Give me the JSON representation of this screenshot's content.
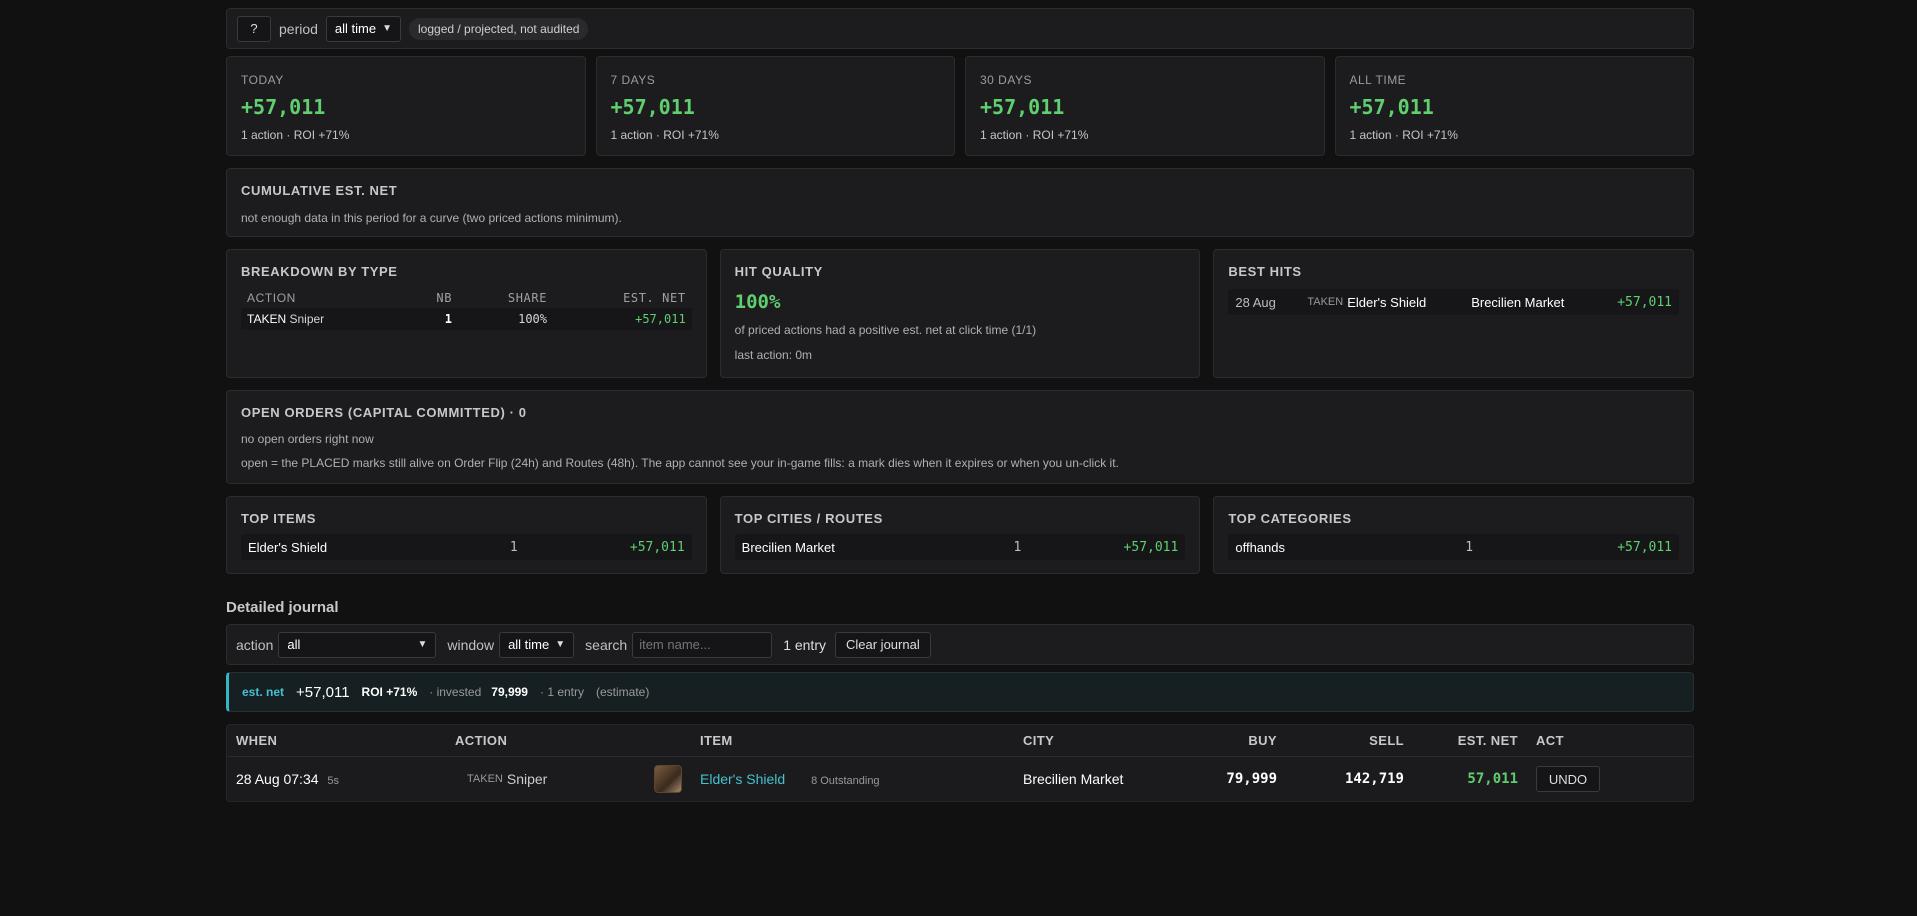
{
  "topbar": {
    "help_label": "?",
    "period_label": "period",
    "period_value": "all time",
    "badge": "logged / projected, not audited"
  },
  "stats": [
    {
      "title": "TODAY",
      "value": "+57,011",
      "sub": "1 action · ROI +71%"
    },
    {
      "title": "7 DAYS",
      "value": "+57,011",
      "sub": "1 action · ROI +71%"
    },
    {
      "title": "30 DAYS",
      "value": "+57,011",
      "sub": "1 action · ROI +71%"
    },
    {
      "title": "ALL TIME",
      "value": "+57,011",
      "sub": "1 action · ROI +71%"
    }
  ],
  "cumulative": {
    "title": "CUMULATIVE EST. NET",
    "desc": "not enough data in this period for a curve (two priced actions minimum)."
  },
  "breakdown": {
    "title": "BREAKDOWN BY TYPE",
    "headers": [
      "ACTION",
      "NB",
      "SHARE",
      "EST. NET"
    ],
    "rows": [
      {
        "tag": "TAKEN",
        "name": "Sniper",
        "nb": "1",
        "share": "100%",
        "net": "+57,011"
      }
    ]
  },
  "hit_quality": {
    "title": "HIT QUALITY",
    "value": "100%",
    "desc": "of priced actions had a positive est. net at click time (1/1)",
    "last": "last action: 0m"
  },
  "best_hits": {
    "title": "BEST HITS",
    "items": [
      {
        "date": "28 Aug",
        "tag": "TAKEN",
        "item": "Elder's Shield",
        "city": "Brecilien Market",
        "net": "+57,011"
      }
    ]
  },
  "open_orders": {
    "title": "OPEN ORDERS (CAPITAL COMMITTED) · 0",
    "line1": "no open orders right now",
    "line2": "open = the PLACED marks still alive on Order Flip (24h) and Routes (48h). The app cannot see your in-game fills: a mark dies when it expires or when you un-click it."
  },
  "top_items": {
    "title": "TOP ITEMS",
    "name": "Elder's Shield",
    "count": "1",
    "net": "+57,011"
  },
  "top_cities": {
    "title": "TOP CITIES / ROUTES",
    "name": "Brecilien Market",
    "count": "1",
    "net": "+57,011"
  },
  "top_categories": {
    "title": "TOP CATEGORIES",
    "name": "offhands",
    "count": "1",
    "net": "+57,011"
  },
  "journal": {
    "title": "Detailed journal",
    "action_label": "action",
    "action_value": "all",
    "window_label": "window",
    "window_value": "all time",
    "search_label": "search",
    "search_placeholder": "item name...",
    "entries": "1 entry",
    "clear_label": "Clear journal"
  },
  "summary": {
    "label": "est. net",
    "net": "+57,011",
    "roi": "ROI +71%",
    "invested_label": "· invested",
    "invested": "79,999",
    "entries": "· 1 entry",
    "note": "(estimate)"
  },
  "table": {
    "headers": [
      "WHEN",
      "ACTION",
      "ITEM",
      "CITY",
      "BUY",
      "SELL",
      "EST. NET",
      "ACT"
    ],
    "rows": [
      {
        "when": "28 Aug 07:34",
        "ago": "5s",
        "tag": "TAKEN",
        "action": "Sniper",
        "item": "Elder's Shield",
        "quality": "8 Outstanding",
        "city": "Brecilien Market",
        "buy": "79,999",
        "sell": "142,719",
        "net": "57,011",
        "act": "UNDO"
      }
    ]
  }
}
